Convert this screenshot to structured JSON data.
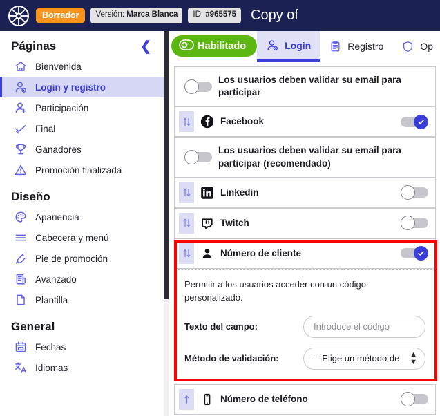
{
  "topbar": {
    "logo_icon": "wheel-logo-icon",
    "draft_badge": "Borrador",
    "version_prefix": "Versión: ",
    "version_value": "Marca Blanca",
    "id_prefix": "ID: ",
    "id_value": "#965575",
    "title": "Copy of"
  },
  "sidebar": {
    "collapse_icon": "chevron-left-icon",
    "sections": [
      {
        "title": "Páginas",
        "items": [
          {
            "label": "Bienvenida",
            "icon": "home-icon",
            "active": false
          },
          {
            "label": "Login y registro",
            "icon": "user-login-icon",
            "active": true
          },
          {
            "label": "Participación",
            "icon": "user-add-icon",
            "active": false
          },
          {
            "label": "Final",
            "icon": "check-badge-icon",
            "active": false
          },
          {
            "label": "Ganadores",
            "icon": "trophy-icon",
            "active": false
          },
          {
            "label": "Promoción finalizada",
            "icon": "warning-triangle-icon",
            "active": false
          }
        ]
      },
      {
        "title": "Diseño",
        "items": [
          {
            "label": "Apariencia",
            "icon": "palette-icon",
            "active": false
          },
          {
            "label": "Cabecera y menú",
            "icon": "menu-lines-icon",
            "active": false
          },
          {
            "label": "Pie de promoción",
            "icon": "footer-icon",
            "active": false
          },
          {
            "label": "Avanzado",
            "icon": "scroll-document-icon",
            "active": false
          },
          {
            "label": "Plantilla",
            "icon": "page-icon",
            "active": false
          }
        ]
      },
      {
        "title": "General",
        "items": [
          {
            "label": "Fechas",
            "icon": "calendar-icon",
            "active": false
          },
          {
            "label": "Idiomas",
            "icon": "translate-icon",
            "active": false
          }
        ]
      }
    ]
  },
  "tabs": [
    {
      "label": "Habilitado",
      "icon": "toggle-on-icon",
      "style": "pill"
    },
    {
      "label": "Login",
      "icon": "user-login-icon",
      "style": "active"
    },
    {
      "label": "Registro",
      "icon": "clipboard-icon",
      "style": "normal"
    },
    {
      "label": "Op",
      "icon": "shield-icon",
      "style": "normal"
    }
  ],
  "rows": [
    {
      "type": "note",
      "label": "Los usuarios deben validar su email para participar",
      "toggle": "off",
      "has_drag": false,
      "icon": null
    },
    {
      "type": "item",
      "label": "Facebook",
      "toggle": "on",
      "has_drag": true,
      "icon": "facebook-icon"
    },
    {
      "type": "note",
      "label": "Los usuarios deben validar su email para participar (recomendado)",
      "toggle": "off",
      "has_drag": false,
      "icon": null
    },
    {
      "type": "item",
      "label": "Linkedin",
      "toggle": "off",
      "has_drag": true,
      "icon": "linkedin-icon"
    },
    {
      "type": "item",
      "label": "Twitch",
      "toggle": "off",
      "has_drag": true,
      "icon": "twitch-icon"
    },
    {
      "type": "item",
      "label": "Número de cliente",
      "toggle": "on",
      "has_drag": true,
      "icon": "person-filled-icon"
    }
  ],
  "expanded_panel": {
    "description": "Permitir a los usuarios acceder con un código personalizado.",
    "fields": [
      {
        "label": "Texto del campo:",
        "kind": "text",
        "value": "",
        "placeholder": "Introduce el código"
      },
      {
        "label": "Método de validación:",
        "kind": "select",
        "value": "-- Elige un método de",
        "placeholder": ""
      }
    ]
  },
  "last_row": {
    "label": "Número de teléfono",
    "toggle": "off",
    "drag_icon": "arrow-up-icon",
    "icon": "phone-icon"
  },
  "colors": {
    "topbar_bg": "#1b2152",
    "draft_badge": "#f7941e",
    "accent": "#3b3fd8",
    "accent_soft": "#d6d6f5",
    "enabled_green": "#5cb811",
    "highlight_red": "#ff0000",
    "toggle_track": "#c6c6cc"
  }
}
